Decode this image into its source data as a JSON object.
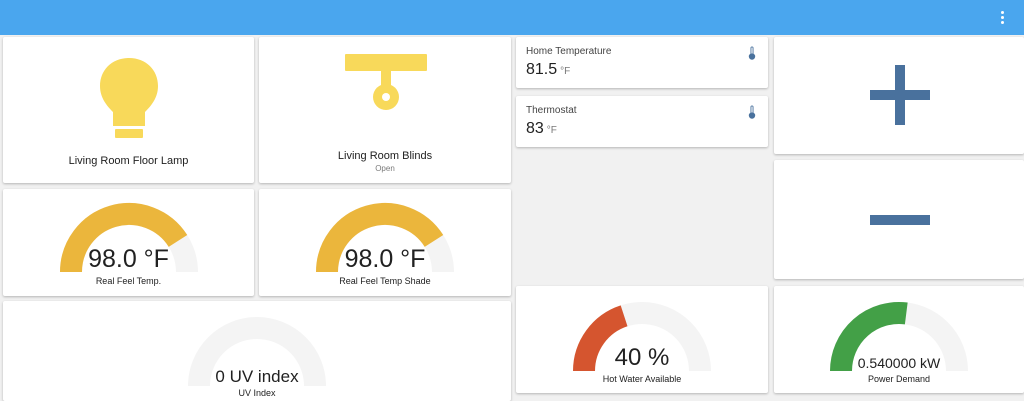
{
  "header": {
    "menu_icon": "dots-vertical-icon"
  },
  "colors": {
    "header": "#4aa6ee",
    "lamp_yellow": "#f8d95a",
    "gauge_yellow": "#ebb63c",
    "gauge_orange": "#d5552f",
    "gauge_green": "#43a047",
    "gauge_track": "#f4f4f4",
    "button_blue": "#49719d"
  },
  "lamp": {
    "label": "Living Room Floor Lamp",
    "icon": "lightbulb-icon"
  },
  "blinds": {
    "label": "Living Room Blinds",
    "state": "Open",
    "icon": "blinds-icon"
  },
  "home_temp": {
    "label": "Home Temperature",
    "value": "81.5",
    "unit": "°F",
    "icon": "thermometer-icon"
  },
  "thermostat": {
    "label": "Thermostat",
    "value": "83",
    "unit": "°F",
    "icon": "thermometer-icon"
  },
  "increase_button": {
    "icon": "plus-icon"
  },
  "decrease_button": {
    "icon": "minus-icon"
  },
  "gauges": {
    "real_feel": {
      "value_text": "98.0 °F",
      "label": "Real Feel Temp.",
      "fraction": 0.82
    },
    "real_feel_shade": {
      "value_text": "98.0 °F",
      "label": "Real Feel Temp Shade",
      "fraction": 0.82
    },
    "uv_index": {
      "value_text": "0 UV index",
      "label": "UV Index",
      "fraction": 0.0
    },
    "hot_water": {
      "value_text": "40 %",
      "label": "Hot Water Available",
      "fraction": 0.4
    },
    "power_demand": {
      "value_text": "0.540000 kW",
      "label": "Power Demand",
      "fraction": 0.54
    }
  }
}
